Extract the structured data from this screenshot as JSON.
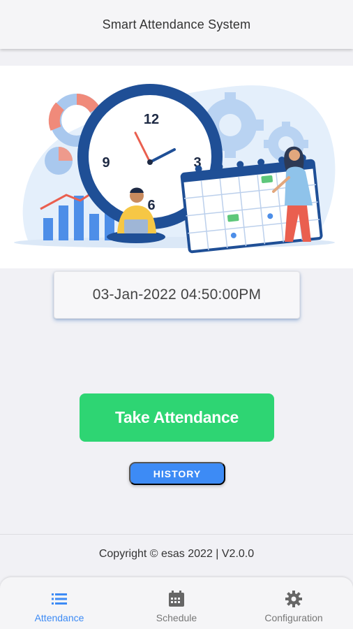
{
  "app_bar": {
    "title": "Smart Attendance System"
  },
  "hero": {
    "illustration": "clock-calendar-illustration",
    "clock_numbers": [
      "12",
      "3",
      "6",
      "9"
    ]
  },
  "datetime": {
    "value": "03-Jan-2022 04:50:00PM"
  },
  "actions": {
    "take_attendance_label": "Take Attendance",
    "history_label": "HISTORY"
  },
  "footer": {
    "copyright": "Copyright © esas 2022 | V2.0.0"
  },
  "bottom_nav": {
    "items": [
      {
        "label": "Attendance",
        "icon": "list-icon",
        "active": true
      },
      {
        "label": "Schedule",
        "icon": "calendar-icon",
        "active": false
      },
      {
        "label": "Configuration",
        "icon": "gear-icon",
        "active": false
      }
    ]
  },
  "colors": {
    "accent": "#3d8bf5",
    "success": "#2ed573",
    "background": "#f1f1f5"
  }
}
